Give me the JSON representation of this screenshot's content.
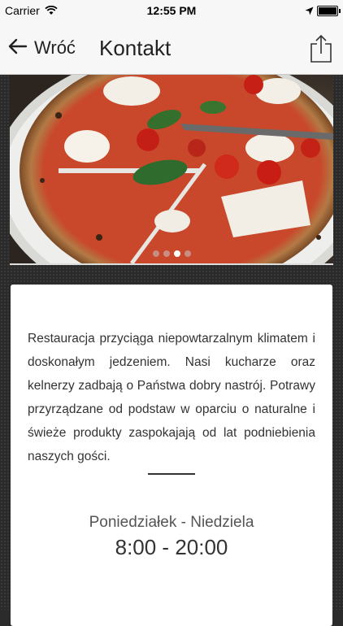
{
  "status_bar": {
    "carrier": "Carrier",
    "time": "12:55 PM"
  },
  "nav": {
    "back_label": "Wróć",
    "title": "Kontakt"
  },
  "slider": {
    "image": "pizza-margherita-photo",
    "dots": 4,
    "active_dot": 3
  },
  "content": {
    "description": "Restauracja przyciąga niepowtarzalnym klimatem i doskonałym jedzeniem. Nasi kucharze oraz kelnerzy zadbają o Państwa dobry nastrój. Potrawy przyrządzane od podstaw w oparciu o naturalne i świeże produkty zaspokajają od lat podniebienia naszych gości.",
    "opening_days": "Poniedziałek - Niedziela",
    "opening_hours": "8:00 - 20:00"
  },
  "colors": {
    "nav_background": "#f7f7f7",
    "page_background": "#2a2a2a",
    "card_background": "#ffffff",
    "text": "#333333"
  }
}
